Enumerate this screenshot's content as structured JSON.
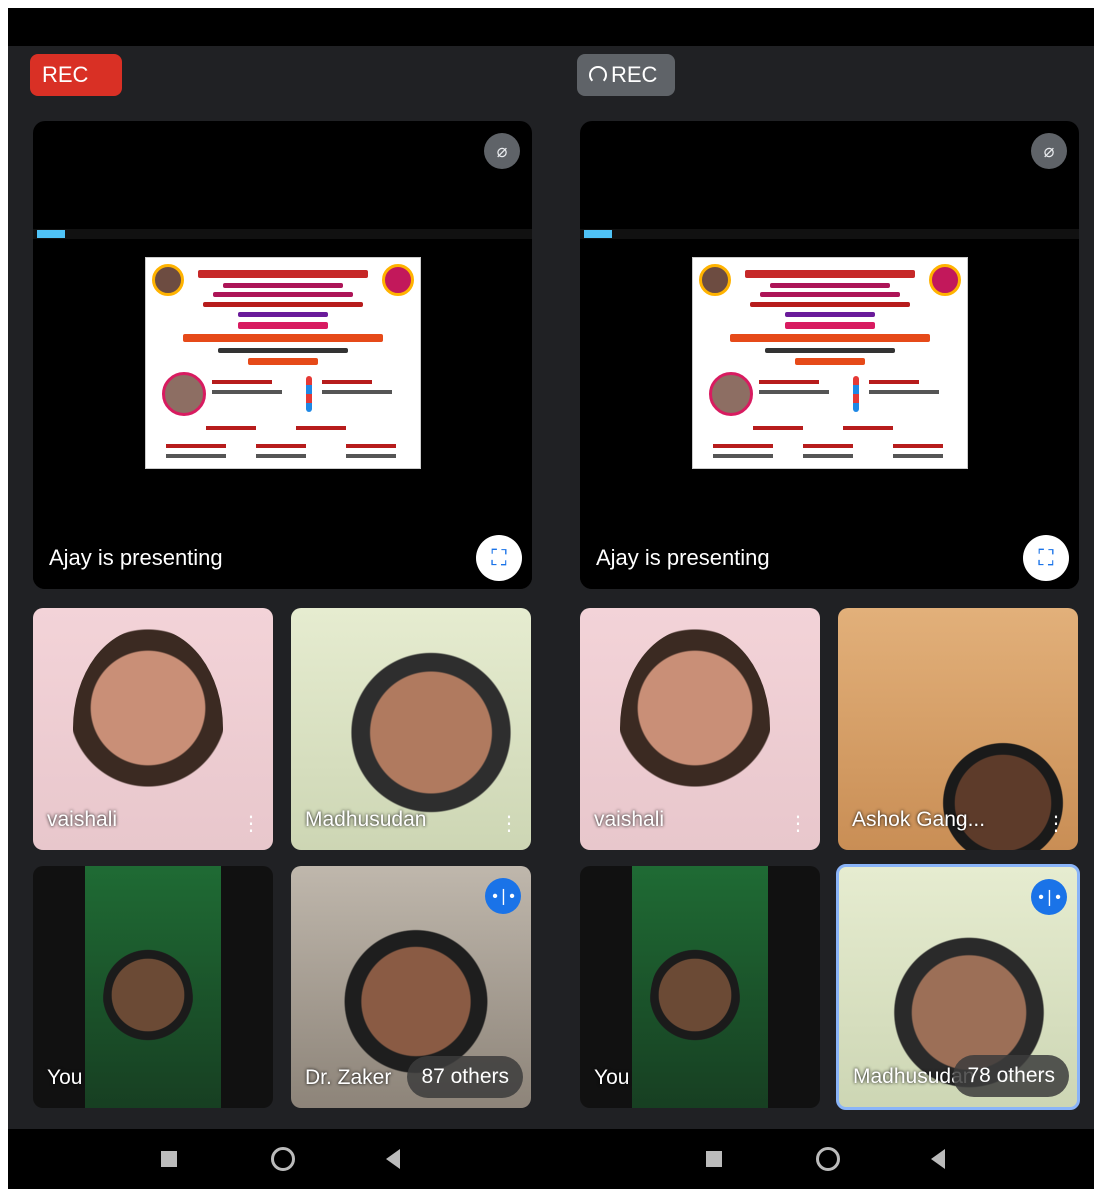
{
  "left": {
    "rec_label": "REC",
    "presenting_label": "Ajay is presenting",
    "tiles": [
      {
        "name": "vaishali"
      },
      {
        "name": "Madhusudan"
      },
      {
        "name": "You"
      },
      {
        "name": "Dr. Zaker",
        "others": "87 others"
      }
    ]
  },
  "right": {
    "rec_label": "REC",
    "presenting_label": "Ajay is presenting",
    "tiles": [
      {
        "name": "vaishali"
      },
      {
        "name": "Ashok Gang..."
      },
      {
        "name": "You"
      },
      {
        "name": "Madhusudan",
        "others": "78 others"
      }
    ]
  },
  "icons": {
    "mute": "mic-off-icon",
    "fullscreen": "fullscreen-icon",
    "more": "more-vert-icon",
    "speaking": "audio-level-icon",
    "nav": [
      "recents-square-icon",
      "home-circle-icon",
      "back-triangle-icon"
    ]
  },
  "colors": {
    "rec_active": "#d93025",
    "rec_pending": "#5f6368",
    "meet_bg": "#202124",
    "speaking_blue": "#1a73e8"
  }
}
